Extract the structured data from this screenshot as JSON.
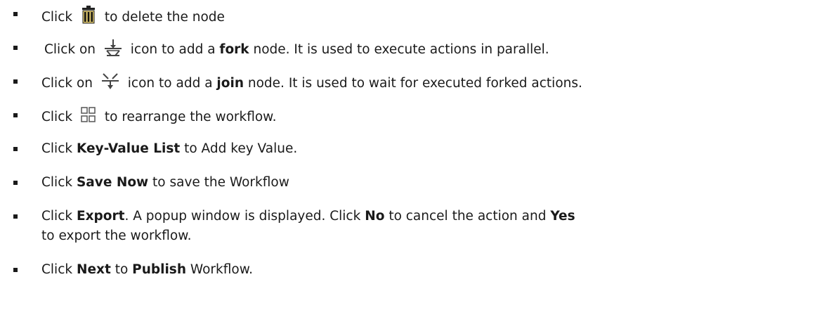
{
  "items": [
    {
      "p1": "Click",
      "p2": "to delete the node",
      "icon": "trash-icon"
    },
    {
      "p1": "Click on",
      "p2": "icon to add a",
      "b1": "fork",
      "p3": "node. It  is used to execute actions in parallel.",
      "icon": "fork-icon"
    },
    {
      "p1": "Click on",
      "p2": "icon to add a",
      "b1": "join",
      "p3": "node. It is used to wait for executed forked actions.",
      "icon": "join-icon"
    },
    {
      "p1": "Click",
      "p2": "to rearrange the workflow.",
      "icon": "grid-icon"
    },
    {
      "p1": "Click",
      "b1": "Key-Value List",
      "p2": "to Add key Value."
    },
    {
      "p1": "Click",
      "b1": "Save Now",
      "p2": "to save the Workflow"
    },
    {
      "p1": "Click",
      "b1": "Export",
      "p2": ". A popup window is displayed. Click",
      "b2": "No",
      "p3": "to cancel the action and",
      "b3": "Yes",
      "p4": "to export the workflow."
    },
    {
      "p1": "Click",
      "b1": "Next",
      "p2": "to",
      "b2": "Publish",
      "p3": "Workflow."
    }
  ]
}
